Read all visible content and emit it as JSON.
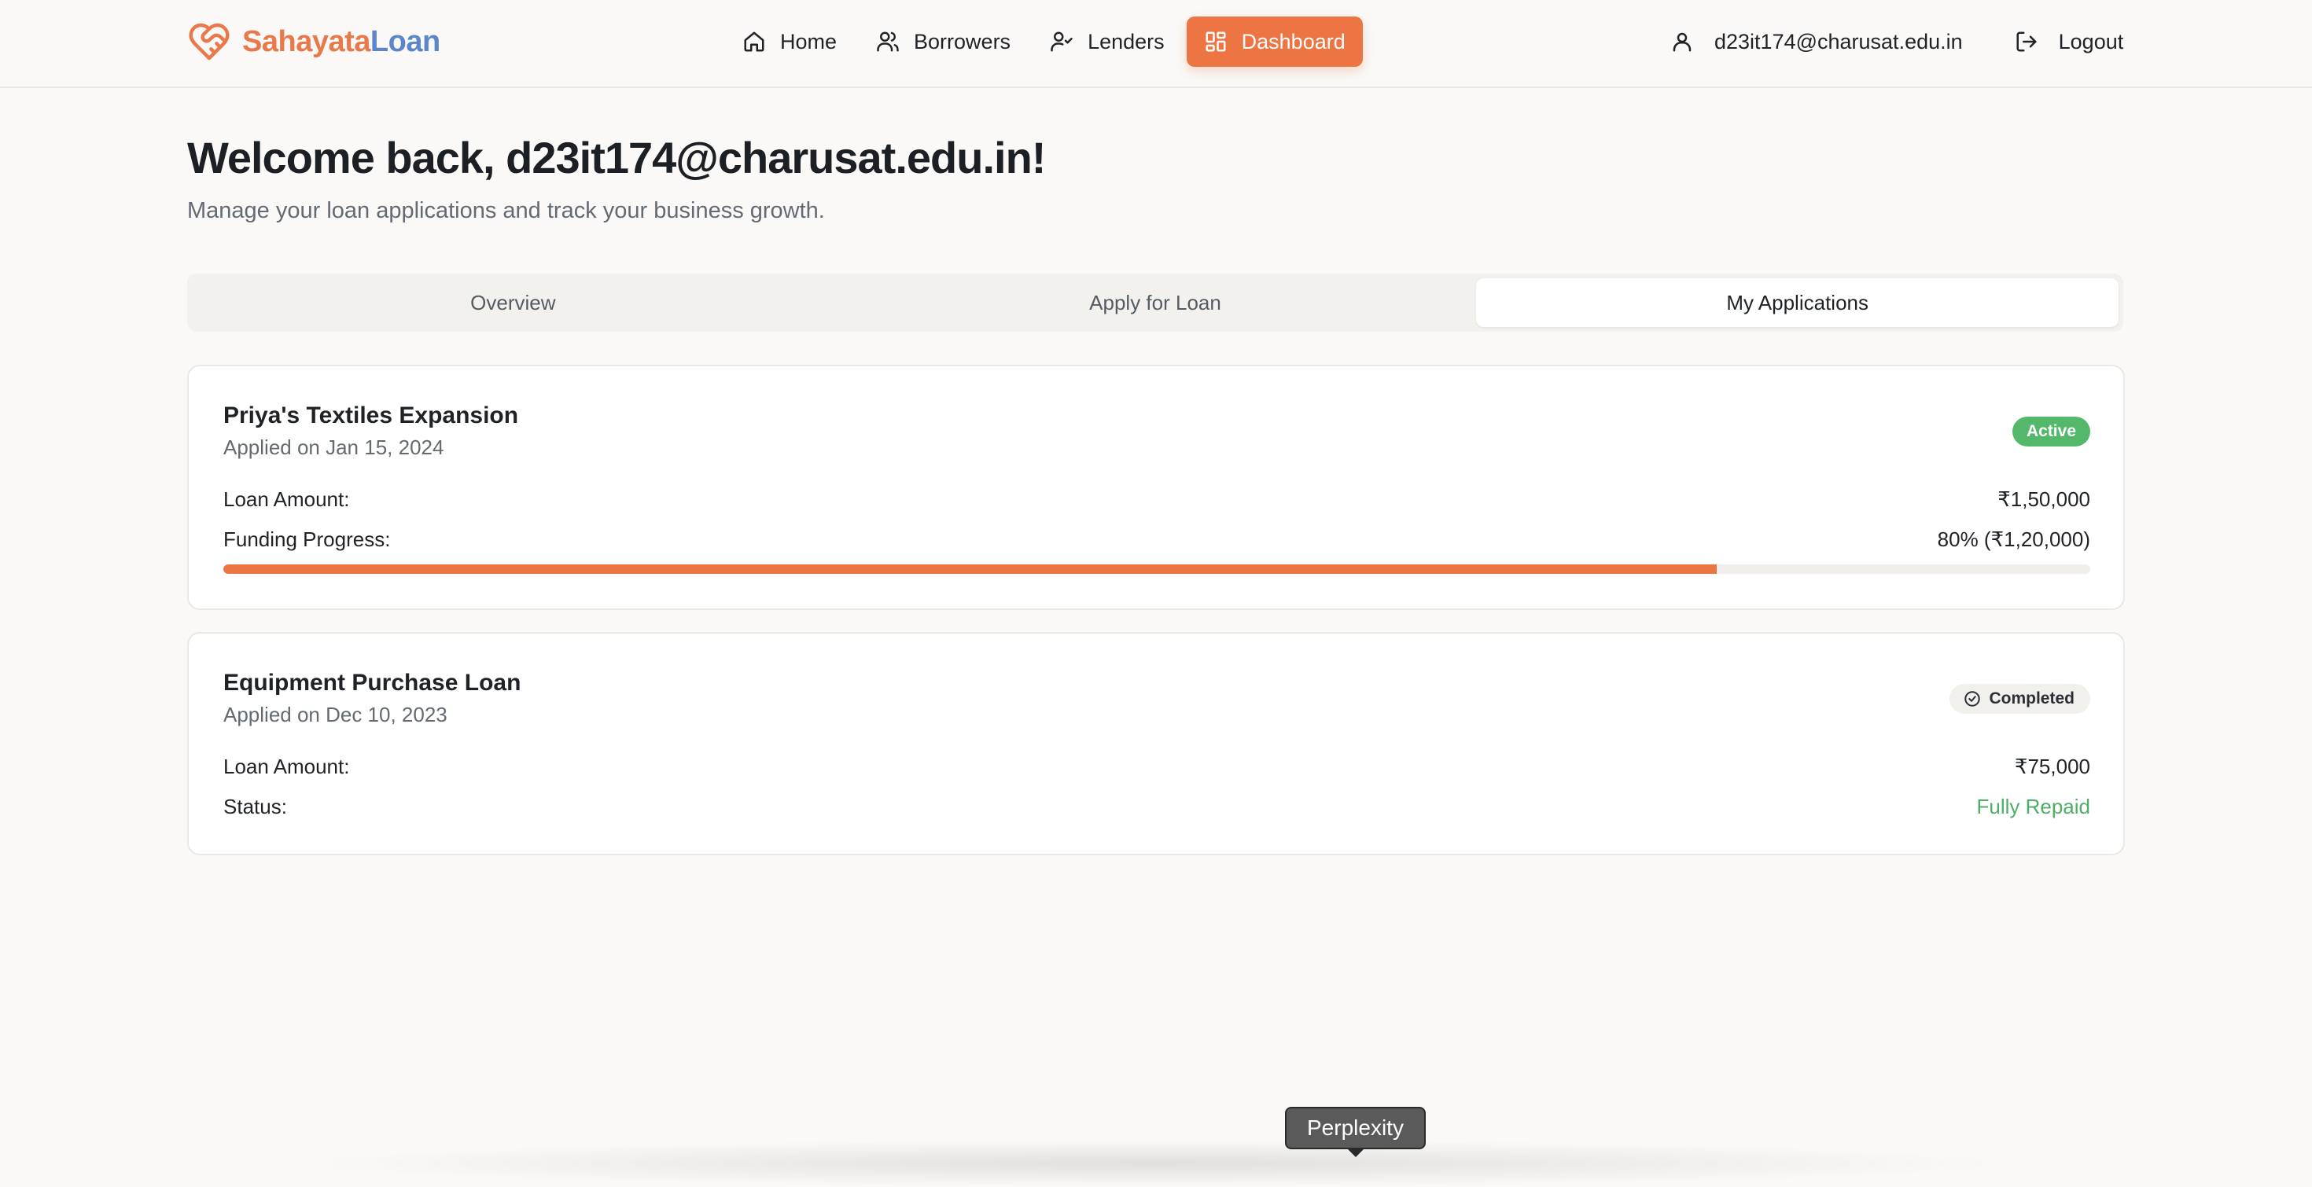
{
  "brand": {
    "name_part1": "Sahayata",
    "name_part2": "Loan",
    "logo_icon": "heart-handshake-icon",
    "color1": "#e9794a",
    "color2": "#5b86c9"
  },
  "nav": {
    "items": [
      {
        "label": "Home",
        "icon": "home-icon"
      },
      {
        "label": "Borrowers",
        "icon": "users-icon"
      },
      {
        "label": "Lenders",
        "icon": "user-check-icon"
      },
      {
        "label": "Dashboard",
        "icon": "layout-grid-icon",
        "active": true
      }
    ],
    "accent": "#ec7543"
  },
  "user": {
    "email": "d23it174@charusat.edu.in",
    "user_icon": "user-icon",
    "logout_label": "Logout",
    "logout_icon": "log-out-icon"
  },
  "main": {
    "welcome": "Welcome back, d23it174@charusat.edu.in!",
    "subtitle": "Manage your loan applications and track your business growth."
  },
  "tabs": [
    {
      "label": "Overview"
    },
    {
      "label": "Apply for Loan"
    },
    {
      "label": "My Applications",
      "active": true
    }
  ],
  "applications": [
    {
      "title": "Priya's Textiles Expansion",
      "date": "Applied on Jan 15, 2024",
      "status": "Active",
      "status_color": "#54b86b",
      "amount_label": "Loan Amount:",
      "amount": "₹1,50,000",
      "progress_label": "Funding Progress:",
      "progress_text": "80% (₹1,20,000)",
      "progress_percent": 80
    },
    {
      "title": "Equipment Purchase Loan",
      "date": "Applied on Dec 10, 2023",
      "status": "Completed",
      "status_icon": "check-circle-icon",
      "amount_label": "Loan Amount:",
      "amount": "₹75,000",
      "status_label": "Status:",
      "status_value": "Fully Repaid",
      "status_value_color": "#4caf66"
    }
  ],
  "tooltip": {
    "label": "Perplexity"
  }
}
